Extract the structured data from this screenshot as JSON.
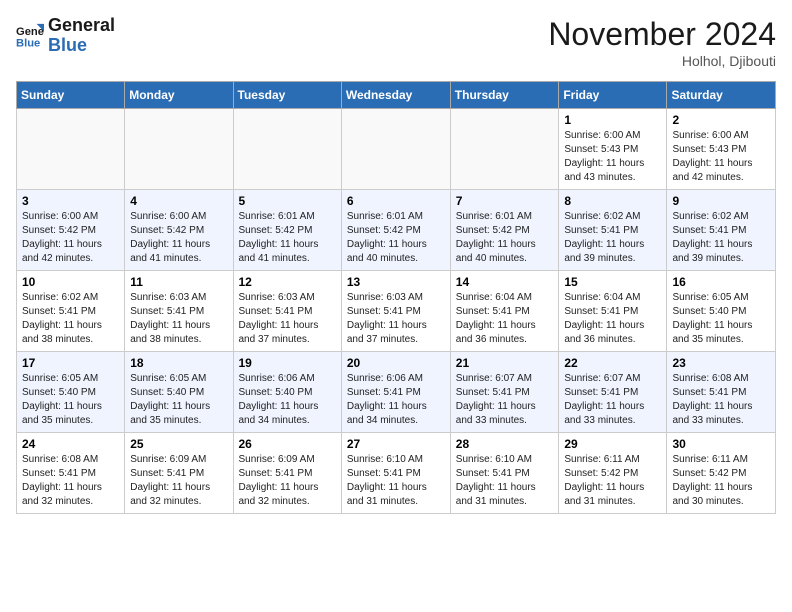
{
  "header": {
    "logo_line1": "General",
    "logo_line2": "Blue",
    "month_title": "November 2024",
    "subtitle": "Holhol, Djibouti"
  },
  "days_of_week": [
    "Sunday",
    "Monday",
    "Tuesday",
    "Wednesday",
    "Thursday",
    "Friday",
    "Saturday"
  ],
  "weeks": [
    [
      {
        "day": "",
        "info": ""
      },
      {
        "day": "",
        "info": ""
      },
      {
        "day": "",
        "info": ""
      },
      {
        "day": "",
        "info": ""
      },
      {
        "day": "",
        "info": ""
      },
      {
        "day": "1",
        "info": "Sunrise: 6:00 AM\nSunset: 5:43 PM\nDaylight: 11 hours\nand 43 minutes."
      },
      {
        "day": "2",
        "info": "Sunrise: 6:00 AM\nSunset: 5:43 PM\nDaylight: 11 hours\nand 42 minutes."
      }
    ],
    [
      {
        "day": "3",
        "info": "Sunrise: 6:00 AM\nSunset: 5:42 PM\nDaylight: 11 hours\nand 42 minutes."
      },
      {
        "day": "4",
        "info": "Sunrise: 6:00 AM\nSunset: 5:42 PM\nDaylight: 11 hours\nand 41 minutes."
      },
      {
        "day": "5",
        "info": "Sunrise: 6:01 AM\nSunset: 5:42 PM\nDaylight: 11 hours\nand 41 minutes."
      },
      {
        "day": "6",
        "info": "Sunrise: 6:01 AM\nSunset: 5:42 PM\nDaylight: 11 hours\nand 40 minutes."
      },
      {
        "day": "7",
        "info": "Sunrise: 6:01 AM\nSunset: 5:42 PM\nDaylight: 11 hours\nand 40 minutes."
      },
      {
        "day": "8",
        "info": "Sunrise: 6:02 AM\nSunset: 5:41 PM\nDaylight: 11 hours\nand 39 minutes."
      },
      {
        "day": "9",
        "info": "Sunrise: 6:02 AM\nSunset: 5:41 PM\nDaylight: 11 hours\nand 39 minutes."
      }
    ],
    [
      {
        "day": "10",
        "info": "Sunrise: 6:02 AM\nSunset: 5:41 PM\nDaylight: 11 hours\nand 38 minutes."
      },
      {
        "day": "11",
        "info": "Sunrise: 6:03 AM\nSunset: 5:41 PM\nDaylight: 11 hours\nand 38 minutes."
      },
      {
        "day": "12",
        "info": "Sunrise: 6:03 AM\nSunset: 5:41 PM\nDaylight: 11 hours\nand 37 minutes."
      },
      {
        "day": "13",
        "info": "Sunrise: 6:03 AM\nSunset: 5:41 PM\nDaylight: 11 hours\nand 37 minutes."
      },
      {
        "day": "14",
        "info": "Sunrise: 6:04 AM\nSunset: 5:41 PM\nDaylight: 11 hours\nand 36 minutes."
      },
      {
        "day": "15",
        "info": "Sunrise: 6:04 AM\nSunset: 5:41 PM\nDaylight: 11 hours\nand 36 minutes."
      },
      {
        "day": "16",
        "info": "Sunrise: 6:05 AM\nSunset: 5:40 PM\nDaylight: 11 hours\nand 35 minutes."
      }
    ],
    [
      {
        "day": "17",
        "info": "Sunrise: 6:05 AM\nSunset: 5:40 PM\nDaylight: 11 hours\nand 35 minutes."
      },
      {
        "day": "18",
        "info": "Sunrise: 6:05 AM\nSunset: 5:40 PM\nDaylight: 11 hours\nand 35 minutes."
      },
      {
        "day": "19",
        "info": "Sunrise: 6:06 AM\nSunset: 5:40 PM\nDaylight: 11 hours\nand 34 minutes."
      },
      {
        "day": "20",
        "info": "Sunrise: 6:06 AM\nSunset: 5:41 PM\nDaylight: 11 hours\nand 34 minutes."
      },
      {
        "day": "21",
        "info": "Sunrise: 6:07 AM\nSunset: 5:41 PM\nDaylight: 11 hours\nand 33 minutes."
      },
      {
        "day": "22",
        "info": "Sunrise: 6:07 AM\nSunset: 5:41 PM\nDaylight: 11 hours\nand 33 minutes."
      },
      {
        "day": "23",
        "info": "Sunrise: 6:08 AM\nSunset: 5:41 PM\nDaylight: 11 hours\nand 33 minutes."
      }
    ],
    [
      {
        "day": "24",
        "info": "Sunrise: 6:08 AM\nSunset: 5:41 PM\nDaylight: 11 hours\nand 32 minutes."
      },
      {
        "day": "25",
        "info": "Sunrise: 6:09 AM\nSunset: 5:41 PM\nDaylight: 11 hours\nand 32 minutes."
      },
      {
        "day": "26",
        "info": "Sunrise: 6:09 AM\nSunset: 5:41 PM\nDaylight: 11 hours\nand 32 minutes."
      },
      {
        "day": "27",
        "info": "Sunrise: 6:10 AM\nSunset: 5:41 PM\nDaylight: 11 hours\nand 31 minutes."
      },
      {
        "day": "28",
        "info": "Sunrise: 6:10 AM\nSunset: 5:41 PM\nDaylight: 11 hours\nand 31 minutes."
      },
      {
        "day": "29",
        "info": "Sunrise: 6:11 AM\nSunset: 5:42 PM\nDaylight: 11 hours\nand 31 minutes."
      },
      {
        "day": "30",
        "info": "Sunrise: 6:11 AM\nSunset: 5:42 PM\nDaylight: 11 hours\nand 30 minutes."
      }
    ]
  ]
}
